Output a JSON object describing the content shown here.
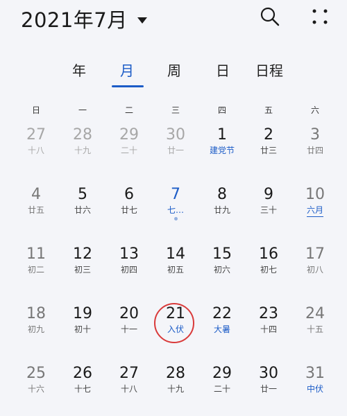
{
  "header": {
    "title": "2021年7月",
    "search_icon": "search-icon",
    "more_icon": "more-icon"
  },
  "tabs": [
    {
      "label": "年"
    },
    {
      "label": "月"
    },
    {
      "label": "周"
    },
    {
      "label": "日"
    },
    {
      "label": "日程"
    }
  ],
  "weekdays": [
    "日",
    "一",
    "二",
    "三",
    "四",
    "五",
    "六"
  ],
  "calendar": {
    "rows": [
      [
        {
          "n": "27",
          "s": "十八",
          "state": "muted"
        },
        {
          "n": "28",
          "s": "十九",
          "state": "muted"
        },
        {
          "n": "29",
          "s": "二十",
          "state": "muted"
        },
        {
          "n": "30",
          "s": "廿一",
          "state": "muted"
        },
        {
          "n": "1",
          "s": "建党节",
          "state": "holiday"
        },
        {
          "n": "2",
          "s": "廿三",
          "state": "normal"
        },
        {
          "n": "3",
          "s": "廿四",
          "state": "weekend"
        }
      ],
      [
        {
          "n": "4",
          "s": "廿五",
          "state": "weekend"
        },
        {
          "n": "5",
          "s": "廿六",
          "state": "normal"
        },
        {
          "n": "6",
          "s": "廿七",
          "state": "normal"
        },
        {
          "n": "7",
          "s": "七…",
          "state": "today"
        },
        {
          "n": "8",
          "s": "廿九",
          "state": "normal"
        },
        {
          "n": "9",
          "s": "三十",
          "state": "normal"
        },
        {
          "n": "10",
          "s": "六月",
          "state": "weekend-underline"
        }
      ],
      [
        {
          "n": "11",
          "s": "初二",
          "state": "weekend"
        },
        {
          "n": "12",
          "s": "初三",
          "state": "normal"
        },
        {
          "n": "13",
          "s": "初四",
          "state": "normal"
        },
        {
          "n": "14",
          "s": "初五",
          "state": "normal"
        },
        {
          "n": "15",
          "s": "初六",
          "state": "normal"
        },
        {
          "n": "16",
          "s": "初七",
          "state": "normal"
        },
        {
          "n": "17",
          "s": "初八",
          "state": "weekend"
        }
      ],
      [
        {
          "n": "18",
          "s": "初九",
          "state": "weekend"
        },
        {
          "n": "19",
          "s": "初十",
          "state": "normal"
        },
        {
          "n": "20",
          "s": "十一",
          "state": "normal"
        },
        {
          "n": "21",
          "s": "入伏",
          "state": "selected"
        },
        {
          "n": "22",
          "s": "大暑",
          "state": "holiday"
        },
        {
          "n": "23",
          "s": "十四",
          "state": "normal"
        },
        {
          "n": "24",
          "s": "十五",
          "state": "weekend"
        }
      ],
      [
        {
          "n": "25",
          "s": "十六",
          "state": "weekend"
        },
        {
          "n": "26",
          "s": "十七",
          "state": "normal"
        },
        {
          "n": "27",
          "s": "十八",
          "state": "normal"
        },
        {
          "n": "28",
          "s": "十九",
          "state": "normal"
        },
        {
          "n": "29",
          "s": "二十",
          "state": "normal"
        },
        {
          "n": "30",
          "s": "廿一",
          "state": "normal"
        },
        {
          "n": "31",
          "s": "中伏",
          "state": "weekend-holiday"
        }
      ]
    ]
  },
  "colors": {
    "accent": "#1c5cc7",
    "selected_ring": "#d93a3a",
    "muted": "#a7a7a7"
  }
}
